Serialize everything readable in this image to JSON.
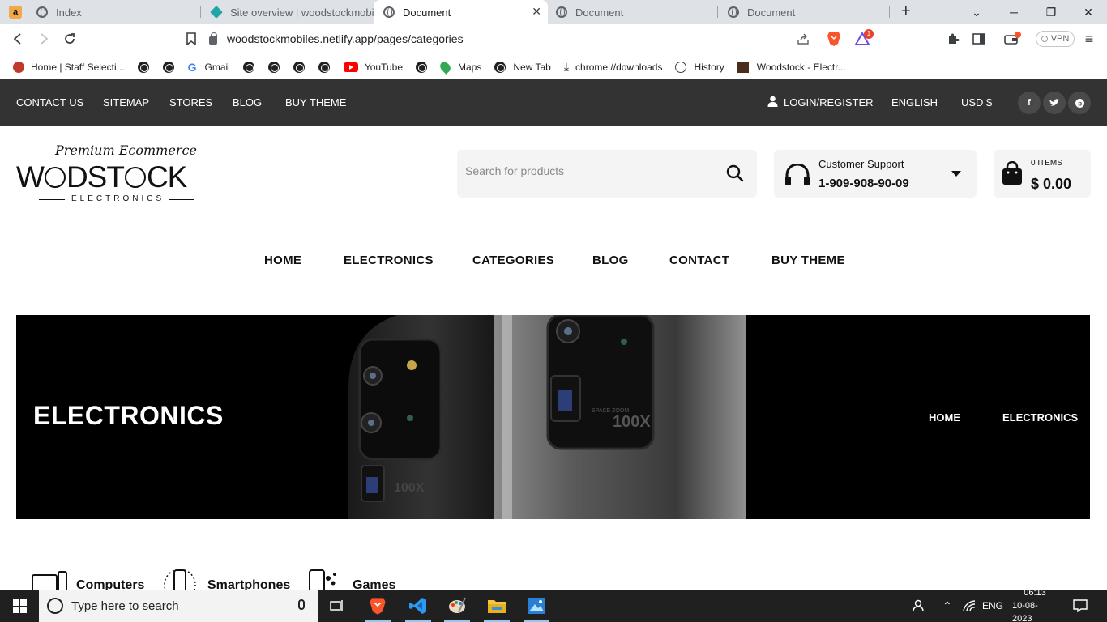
{
  "browser": {
    "tabs": [
      {
        "title": "Index",
        "active": false
      },
      {
        "title": "Site overview | woodstockmobiles",
        "active": false
      },
      {
        "title": "Document",
        "active": true
      },
      {
        "title": "Document",
        "active": false
      },
      {
        "title": "Document",
        "active": false
      }
    ],
    "new_tab_symbol": "+",
    "url": "woodstockmobiles.netlify.app/pages/categories",
    "shield_badge": "1",
    "vpn_label": "VPN",
    "bookmarks": [
      {
        "label": "Home | Staff Selecti...",
        "icon": "staff-icon"
      },
      {
        "label": "",
        "icon": "globe-icon"
      },
      {
        "label": "",
        "icon": "globe-icon"
      },
      {
        "label": "Gmail",
        "icon": "google-icon"
      },
      {
        "label": "",
        "icon": "globe-icon"
      },
      {
        "label": "",
        "icon": "globe-icon"
      },
      {
        "label": "",
        "icon": "globe-icon"
      },
      {
        "label": "",
        "icon": "globe-icon"
      },
      {
        "label": "YouTube",
        "icon": "youtube-icon"
      },
      {
        "label": "",
        "icon": "globe-icon"
      },
      {
        "label": "Maps",
        "icon": "maps-icon"
      },
      {
        "label": "New Tab",
        "icon": "globe-icon"
      },
      {
        "label": "chrome://downloads",
        "icon": "download-icon"
      },
      {
        "label": "History",
        "icon": "history-icon"
      },
      {
        "label": "Woodstock - Electr...",
        "icon": "woodstock-icon"
      }
    ]
  },
  "site": {
    "topbar": {
      "links": [
        "CONTACT US",
        "SITEMAP",
        "STORES",
        "BLOG",
        "BUY THEME"
      ],
      "login": "LOGIN/REGISTER",
      "language": "ENGLISH",
      "currency": "USD $"
    },
    "logo": {
      "tagline": "Premium Ecommerce",
      "brand_first": "W",
      "brand_rest": "DST",
      "brand_end": "CK",
      "sub": "ELECTRONICS"
    },
    "search": {
      "placeholder": "Search for products"
    },
    "support": {
      "label": "Customer Support",
      "phone": "1-909-908-90-09"
    },
    "cart": {
      "items": "0 ITEMS",
      "total": "$ 0.00"
    },
    "nav": [
      "HOME",
      "ELECTRONICS",
      "CATEGORIES",
      "BLOG",
      "CONTACT",
      "BUY THEME"
    ],
    "hero": {
      "title": "ELECTRONICS",
      "breadcrumb": [
        "HOME",
        "ELECTRONICS"
      ],
      "camera_text": "100X",
      "camera_sub": "SPACE ZOOM"
    },
    "categories": [
      "Computers",
      "Smartphones",
      "Games"
    ]
  },
  "taskbar": {
    "search_placeholder": "Type here to search",
    "language": "ENG",
    "time": "06:13",
    "date": "10-08-2023"
  },
  "colors": {
    "topbar_bg": "#333333",
    "hero_bg": "#000000",
    "taskbar_bg": "#202020",
    "brave_orange": "#fb542b"
  }
}
